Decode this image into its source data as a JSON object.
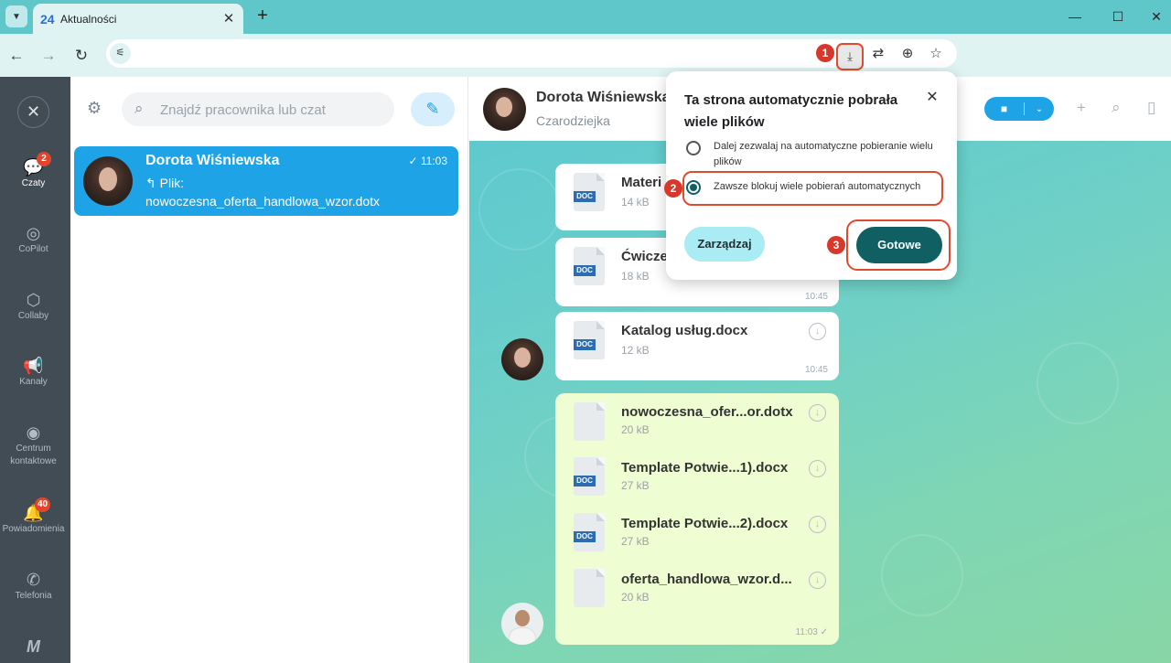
{
  "browser": {
    "tab_title": "Aktualności",
    "tab_favicon": "24",
    "tab_close_icon": "✕",
    "new_tab_icon": "+",
    "nav_icons": {
      "back": "←",
      "forward": "→",
      "reload": "↻"
    },
    "omnibox_icons": {
      "translate": "⇄",
      "zoom": "⊕",
      "bookmark": "☆",
      "download": "⤓"
    },
    "window_controls": {
      "minimize": "—",
      "maximize": "☐",
      "close": "✕"
    }
  },
  "steps": [
    "1",
    "2",
    "3"
  ],
  "rail": {
    "close_icon": "✕",
    "items": [
      {
        "label": "Czaty",
        "icon": "chats-icon",
        "glyph": "💬",
        "badge": "2"
      },
      {
        "label": "CoPilot",
        "icon": "copilot-icon",
        "glyph": "◎"
      },
      {
        "label": "Collaby",
        "icon": "collaby-icon",
        "glyph": "⬡"
      },
      {
        "label": "Kanały",
        "icon": "megaphone-icon",
        "glyph": "📢"
      },
      {
        "label": "Centrum kontaktowe",
        "icon": "contact-center-icon",
        "glyph": "◉"
      },
      {
        "label": "Powiadomienia",
        "icon": "bell-icon",
        "glyph": "🔔",
        "badge": "40"
      },
      {
        "label": "Telefonia",
        "icon": "phone-icon",
        "glyph": "✆"
      },
      {
        "label": "",
        "icon": "logo-icon",
        "glyph": "M"
      }
    ]
  },
  "chatlist": {
    "search_placeholder": "Znajdź pracownika lub czat",
    "filter_icon": "⚙",
    "compose_icon": "✎",
    "search_icon": "⌕",
    "items": [
      {
        "name": "Dorota Wiśniewska",
        "time": "✓ 11:03",
        "preview_line1": "↰ Plik:",
        "preview_line2": "nowoczesna_oferta_handlowa_wzor.dotx"
      }
    ]
  },
  "conversation": {
    "name": "Dorota Wiśniewska",
    "subtitle": "Czarodziejka",
    "video_icon": "■",
    "video_chevron": "⌄",
    "add_user_icon": "+",
    "search_icon": "⌕",
    "panel_icon": "▯",
    "messages": [
      {
        "file": "Materi",
        "size": "14 kB",
        "time": "",
        "icon": "DOC"
      },
      {
        "file": "Ćwiczer",
        "size": "18 kB",
        "time": "10:45",
        "icon": "DOC"
      },
      {
        "file": "Katalog usług.docx",
        "size": "12 kB",
        "time": "10:45",
        "icon": "DOC"
      }
    ],
    "my_files": [
      {
        "file": "nowoczesna_ofer...or.dotx",
        "size": "20 kB",
        "icon": ""
      },
      {
        "file": "Template Potwie...1).docx",
        "size": "27 kB",
        "icon": "DOC"
      },
      {
        "file": "Template Potwie...2).docx",
        "size": "27 kB",
        "icon": "DOC"
      },
      {
        "file": "oferta_handlowa_wzor.d...",
        "size": "20 kB",
        "icon": ""
      }
    ],
    "my_time": "11:03 ✓",
    "download_glyph": "↓"
  },
  "popup": {
    "title": "Ta strona automatycznie pobrała wiele plików",
    "close_icon": "✕",
    "option_allow": "Dalej zezwalaj na automatyczne pobieranie wielu plików",
    "option_block": "Zawsze blokuj wiele pobierań automatycznych",
    "selected": "block",
    "manage_label": "Zarządzaj",
    "done_label": "Gotowe"
  },
  "colors": {
    "accent": "#1da3e6",
    "chrome": "#5fc6c9",
    "done_button": "#0f5f63",
    "highlight": "#e04a2e",
    "rail": "#414c55"
  }
}
